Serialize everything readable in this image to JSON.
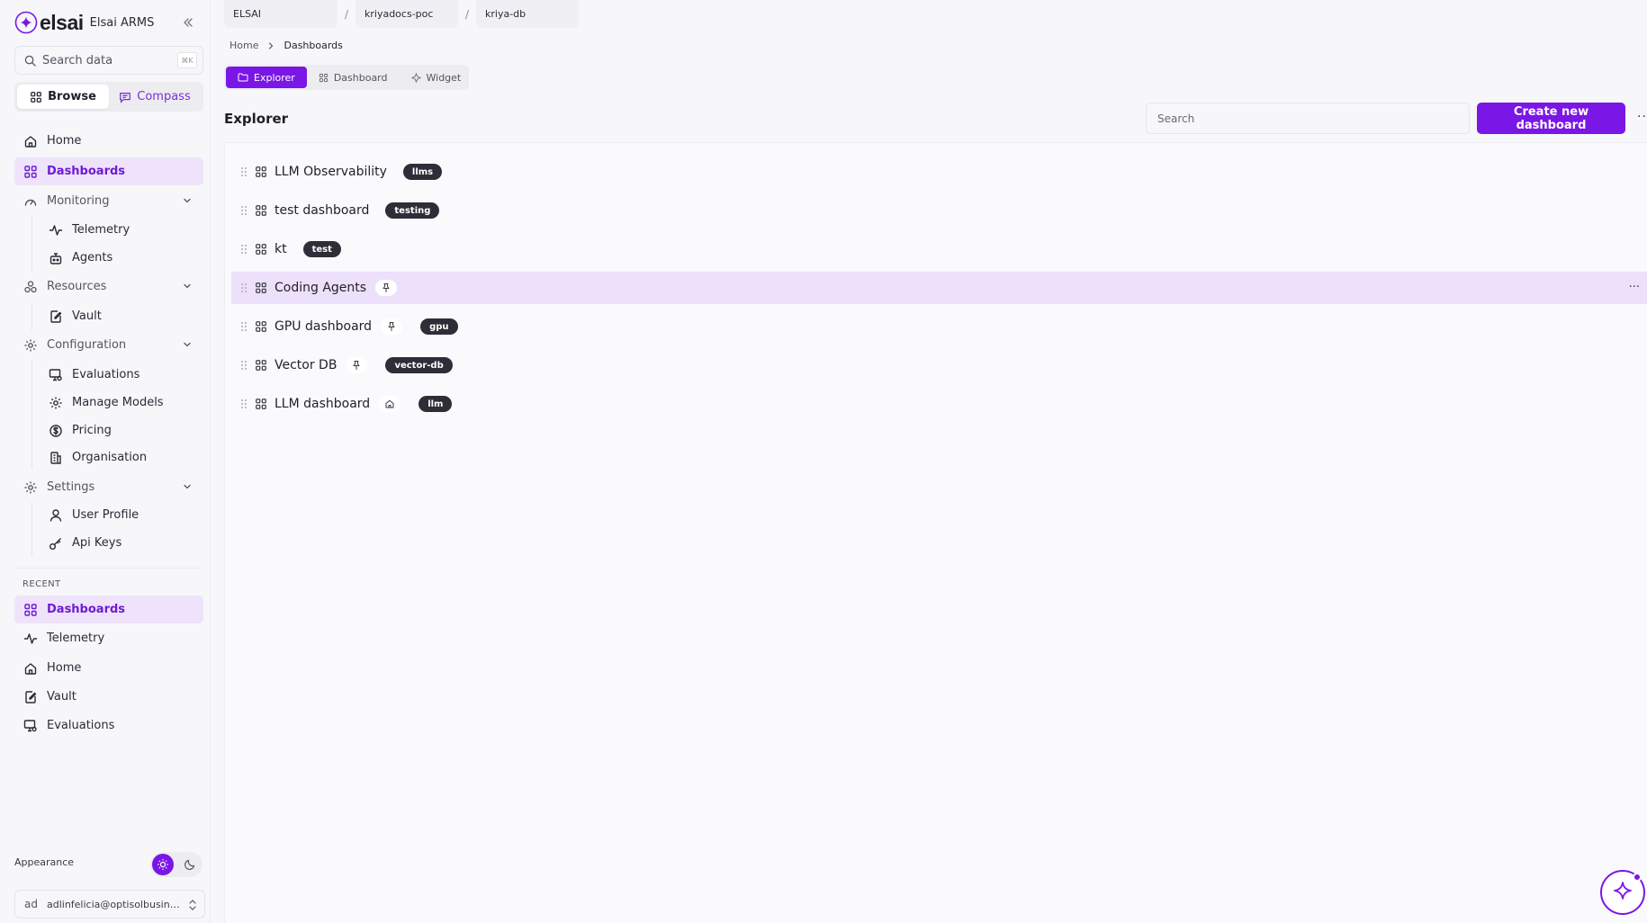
{
  "app": {
    "brand": "elsai",
    "app_name": "Elsai ARMS",
    "accent_color": "#7a16e6"
  },
  "sidebar": {
    "search_placeholder": "Search data",
    "search_shortcut": "⌘K",
    "modes": [
      {
        "label": "Browse",
        "icon": "grid-icon",
        "active": true
      },
      {
        "label": "Compass",
        "icon": "chat-icon",
        "active": false
      }
    ],
    "nav": {
      "home": "Home",
      "dashboards": "Dashboards",
      "monitoring": "Monitoring",
      "telemetry": "Telemetry",
      "agents": "Agents",
      "resources": "Resources",
      "vault": "Vault",
      "configuration": "Configuration",
      "evaluations": "Evaluations",
      "manage_models": "Manage Models",
      "pricing": "Pricing",
      "organisation": "Organisation",
      "settings": "Settings",
      "user_profile": "User Profile",
      "api_keys": "Api Keys"
    },
    "recent_label": "RECENT",
    "recent": [
      "Dashboards",
      "Telemetry",
      "Home",
      "Vault",
      "Evaluations"
    ],
    "appearance_label": "Appearance",
    "user": {
      "initials": "ad",
      "email": "adlinfelicia@optisolbusiness.com"
    }
  },
  "top_tabs": [
    "ELSAI",
    "kriyadocs-poc",
    "kriya-db"
  ],
  "top_tab_separator": "/",
  "breadcrumb": {
    "home": "Home",
    "current": "Dashboards"
  },
  "view_tabs": [
    {
      "label": "Explorer",
      "active": true
    },
    {
      "label": "Dashboard",
      "active": false
    },
    {
      "label": "Widget",
      "active": false
    }
  ],
  "explorer": {
    "title": "Explorer",
    "search_placeholder": "Search",
    "create_button": "Create new dashboard",
    "more": "···"
  },
  "dashboards": [
    {
      "name": "LLM Observability",
      "tag": "llms",
      "pin": null,
      "highlighted": false
    },
    {
      "name": "test dashboard",
      "tag": "testing",
      "pin": null,
      "highlighted": false
    },
    {
      "name": "kt",
      "tag": "test",
      "pin": null,
      "highlighted": false
    },
    {
      "name": "Coding Agents",
      "tag": null,
      "pin": "pin-icon",
      "highlighted": true
    },
    {
      "name": "GPU dashboard",
      "tag": "gpu",
      "pin": "pin-icon",
      "highlighted": false
    },
    {
      "name": "Vector DB",
      "tag": "vector-db",
      "pin": "pin-icon",
      "highlighted": false
    },
    {
      "name": "LLM dashboard",
      "tag": "llm",
      "pin": "home-icon",
      "highlighted": false
    }
  ],
  "row_more": "···"
}
